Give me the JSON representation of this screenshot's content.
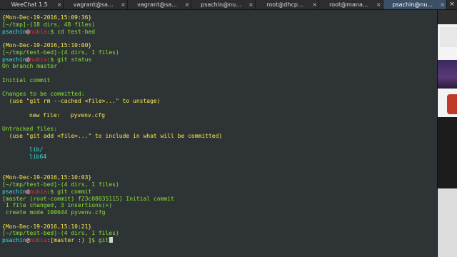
{
  "tabs": [
    {
      "label": "WeeChat 1.5",
      "active": false
    },
    {
      "label": "vagrant@sa...",
      "active": false
    },
    {
      "label": "vagrant@sa...",
      "active": false
    },
    {
      "label": "psachin@nu...",
      "active": false
    },
    {
      "label": "root@dhcp...",
      "active": false
    },
    {
      "label": "root@mana...",
      "active": false
    },
    {
      "label": "psachin@nu...",
      "active": true
    }
  ],
  "tab_close_glyph": "×",
  "window_close_glyph": "×",
  "colors": {
    "terminal_bg": "#2e3436",
    "yellow": "#fce94f",
    "green": "#8ae234",
    "cyan": "#34e2e2",
    "red": "#ef2929",
    "active_tab": "#3b4f66"
  },
  "terminal": {
    "b1_date": "{Mon-Dec-19-2016,15:09:36}",
    "b1_dir": "[~/tmp]-(18 dirs, 48 files)",
    "b1_user": "psachin",
    "b1_at": "@",
    "b1_host": "nubia",
    "b1_sep": ":",
    "b1_cmd": "$ cd test-bed",
    "b2_date": "{Mon-Dec-19-2016,15:10:00}",
    "b2_dir": "[~/tmp/test-bed]-(4 dirs, 1 files)",
    "b2_user": "psachin",
    "b2_at": "@",
    "b2_host": "nubia",
    "b2_sep": ":",
    "b2_cmd": "$ git status",
    "status_1": "On branch master",
    "status_2": "Initial commit",
    "status_3": "Changes to be committed:",
    "status_4": "  (use \"git rm --cached <file>...\" to unstage)",
    "status_new_label": "new file:   ",
    "status_new_file": "pyvenv.cfg",
    "status_5": "Untracked files:",
    "status_6": "  (use \"git add <file>...\" to include in what will be committed)",
    "untracked_1": "lib/",
    "untracked_2": "lib64",
    "b3_date": "{Mon-Dec-19-2016,15:10:03}",
    "b3_dir": "[~/tmp/test-bed]-(4 dirs, 1 files)",
    "b3_user": "psachin",
    "b3_at": "@",
    "b3_host": "nubia",
    "b3_sep": ":",
    "b3_cmd": "$ git commit",
    "commit_1": "[master (root-commit) f23c08035115] Initial commit",
    "commit_2": " 1 file changed, 3 insertions(+)",
    "commit_3": " create mode 100644 pyvenv.cfg",
    "b4_date": "{Mon-Dec-19-2016,15:10:21}",
    "b4_dir": "[~/tmp/test-bed]-(4 dirs, 1 files)",
    "b4_user": "psachin",
    "b4_at": "@",
    "b4_host": "nubia",
    "b4_sep": ":",
    "b4_branch": "[master :) ]",
    "b4_cmd": "$ git"
  }
}
